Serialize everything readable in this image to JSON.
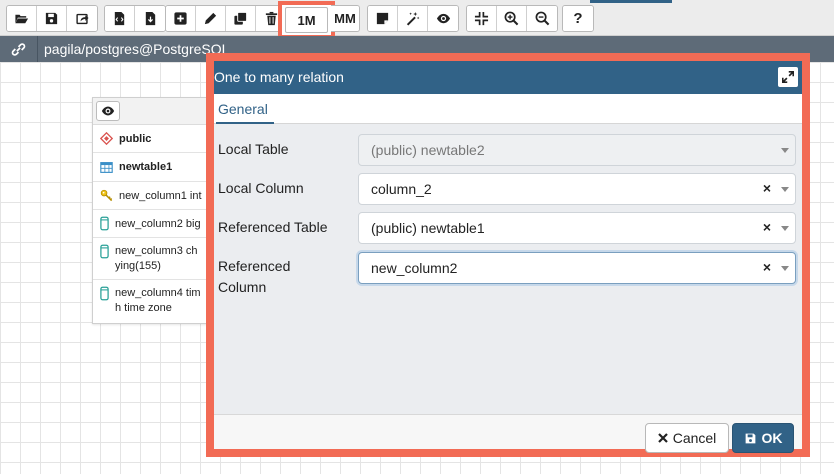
{
  "toolbar": {
    "one_to_many_label": "1M",
    "many_to_many_label": "MM",
    "help_label": "?"
  },
  "titlebar": {
    "connection": "pagila/postgres@PostgreSQL"
  },
  "node": {
    "schema": "public",
    "table": "newtable1",
    "columns": [
      {
        "text": "new_column1 int"
      },
      {
        "text": "new_column2 big"
      },
      {
        "line1": "new_column3 ch",
        "line2": "ying(155)"
      },
      {
        "line1": "new_column4 tim",
        "line2": "h time zone"
      }
    ]
  },
  "dialog": {
    "title": "One to many relation",
    "tab": "General",
    "fields": {
      "local_table": {
        "label": "Local Table",
        "value": "(public) newtable2"
      },
      "local_column": {
        "label": "Local Column",
        "value": "column_2"
      },
      "referenced_table": {
        "label": "Referenced Table",
        "value": "(public) newtable1"
      },
      "referenced_column": {
        "label_line1": "Referenced",
        "label_line2": "Column",
        "value": "new_column2"
      }
    },
    "clear_symbol": "×",
    "cancel_label": "Cancel",
    "ok_label": "OK"
  },
  "colors": {
    "accent": "#316287",
    "highlight": "#f26b55",
    "titlebar": "#5e6b78"
  }
}
